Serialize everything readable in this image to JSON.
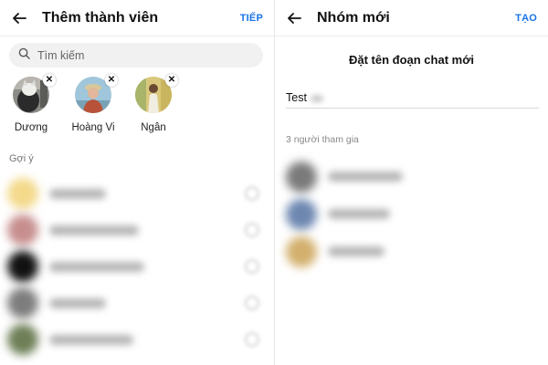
{
  "left": {
    "title": "Thêm thành viên",
    "action": "TIẾP",
    "search_placeholder": "Tìm kiếm",
    "selected": [
      {
        "name": "Dương"
      },
      {
        "name": "Hoàng Vi"
      },
      {
        "name": "Ngân"
      }
    ],
    "section_label": "Gợi ý"
  },
  "right": {
    "title": "Nhóm mới",
    "action": "TẠO",
    "heading": "Đặt tên đoạn chat mới",
    "group_name": "Test",
    "participants_label": "3 người tham gia"
  },
  "colors": {
    "accent": "#1a73e8",
    "search_bg": "#f1f1f1"
  },
  "icons": {
    "back": "arrow-left-icon",
    "search": "search-icon",
    "remove": "close-icon"
  },
  "remove_glyph": "✕"
}
